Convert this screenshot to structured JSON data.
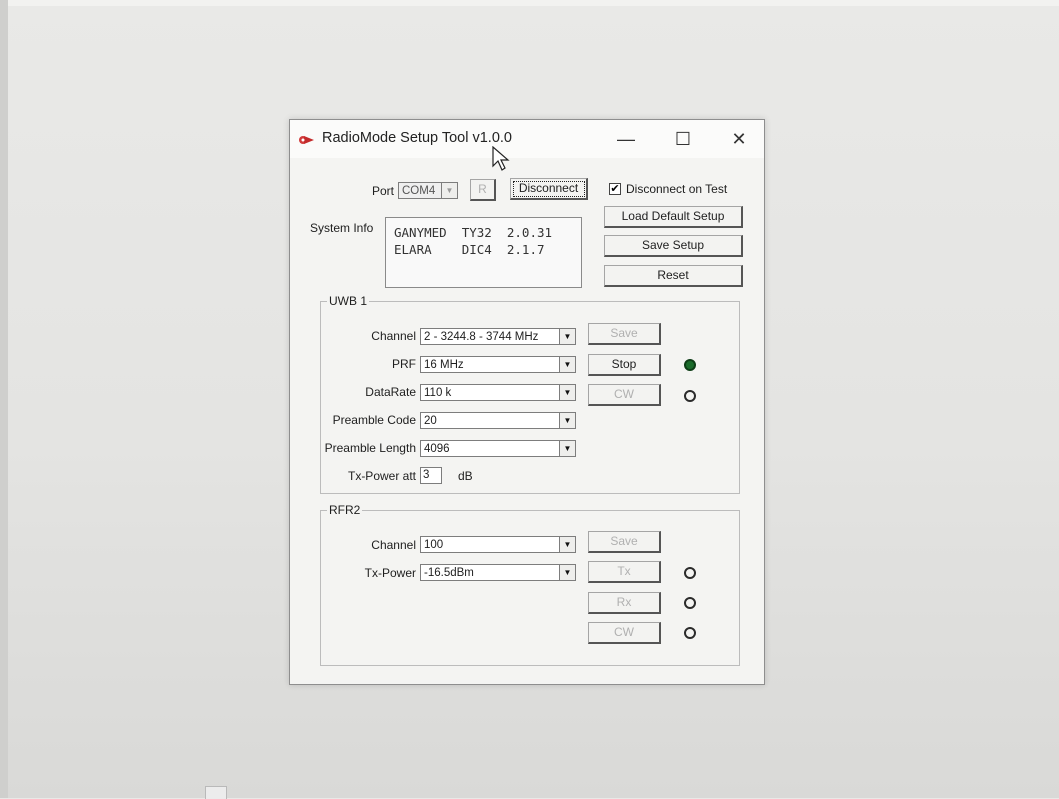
{
  "window": {
    "title": "RadioMode Setup Tool v1.0.0",
    "minimize_glyph": "—",
    "maximize_glyph": "☐",
    "close_glyph": "✕",
    "app_icon": "radiomode-app-icon"
  },
  "connection": {
    "port_label": "Port",
    "port_value": "COM4",
    "refresh_label": "R",
    "disconnect_label": "Disconnect",
    "disconnect_on_test_label": "Disconnect on Test",
    "disconnect_on_test_checked": true,
    "checkbox_glyph": "✔"
  },
  "system_info": {
    "label": "System Info",
    "lines": [
      "GANYMED  TY32  2.0.31",
      "ELARA    DIC4  2.1.7"
    ]
  },
  "setup_buttons": {
    "load_default": "Load Default Setup",
    "save_setup": "Save Setup",
    "reset": "Reset"
  },
  "uwb1": {
    "caption": "UWB 1",
    "channel_label": "Channel",
    "channel_value": "2 - 3244.8 - 3744 MHz",
    "prf_label": "PRF",
    "prf_value": "16 MHz",
    "datarate_label": "DataRate",
    "datarate_value": "110 k",
    "preamble_code_label": "Preamble Code",
    "preamble_code_value": "20",
    "preamble_length_label": "Preamble Length",
    "preamble_length_value": "4096",
    "txpower_label": "Tx-Power att",
    "txpower_value": "3",
    "txpower_unit": "dB",
    "save_label": "Save",
    "stop_label": "Stop",
    "cw_label": "CW",
    "status_on_color": "#1a6b2a"
  },
  "rfr2": {
    "caption": "RFR2",
    "channel_label": "Channel",
    "channel_value": "100",
    "txpower_label": "Tx-Power",
    "txpower_value": "-16.5dBm",
    "save_label": "Save",
    "tx_label": "Tx",
    "rx_label": "Rx",
    "cw_label": "CW"
  },
  "dropdown_arrow": "▼"
}
